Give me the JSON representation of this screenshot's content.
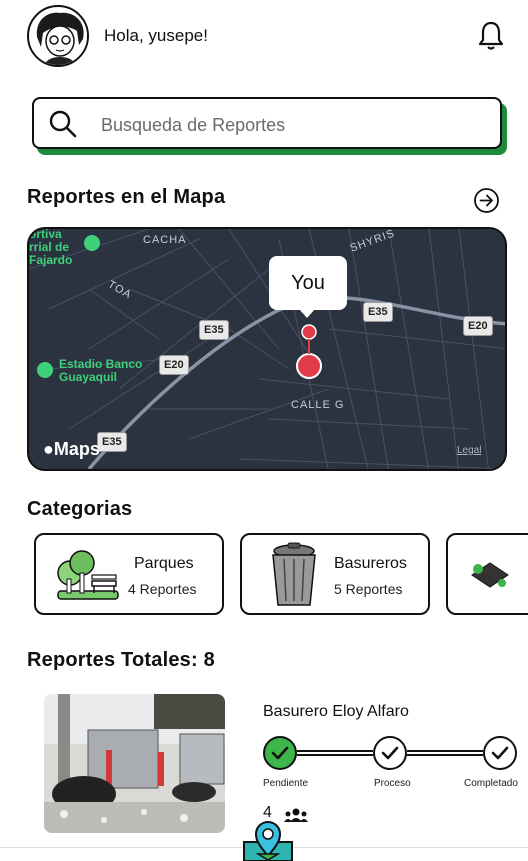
{
  "header": {
    "greeting": "Hola, yusepe!"
  },
  "search": {
    "placeholder": "Busqueda de Reportes"
  },
  "map_section": {
    "title": "Reportes en el Mapa",
    "you_label": "You",
    "attribution": "Maps",
    "legal": "Legal",
    "place_labels": {
      "fajardo": "ortiva\nrrial de\nFajardo",
      "estadio": "Estadio Banco\nGuayaquil",
      "cacha": "CACHA",
      "shyris": "SHYRIS",
      "calle_g": "CALLE G",
      "toa": "TOA",
      "e35_a": "E35",
      "e35_b": "E35",
      "e35_c": "E35",
      "e20_a": "E20",
      "e20_b": "E20"
    }
  },
  "categories": {
    "title": "Categorias",
    "items": [
      {
        "name": "Parques",
        "count": "4 Reportes"
      },
      {
        "name": "Basureros",
        "count": "5 Reportes"
      }
    ]
  },
  "reports": {
    "title": "Reportes Totales: 8",
    "items": [
      {
        "title": "Basurero Eloy Alfaro",
        "steps": [
          "Pendiente",
          "Proceso",
          "Completado"
        ],
        "votes": "4"
      }
    ]
  },
  "colors": {
    "accent_green": "#1f8a3a",
    "step_done": "#3cb54a",
    "map_bg": "#2b3240"
  }
}
